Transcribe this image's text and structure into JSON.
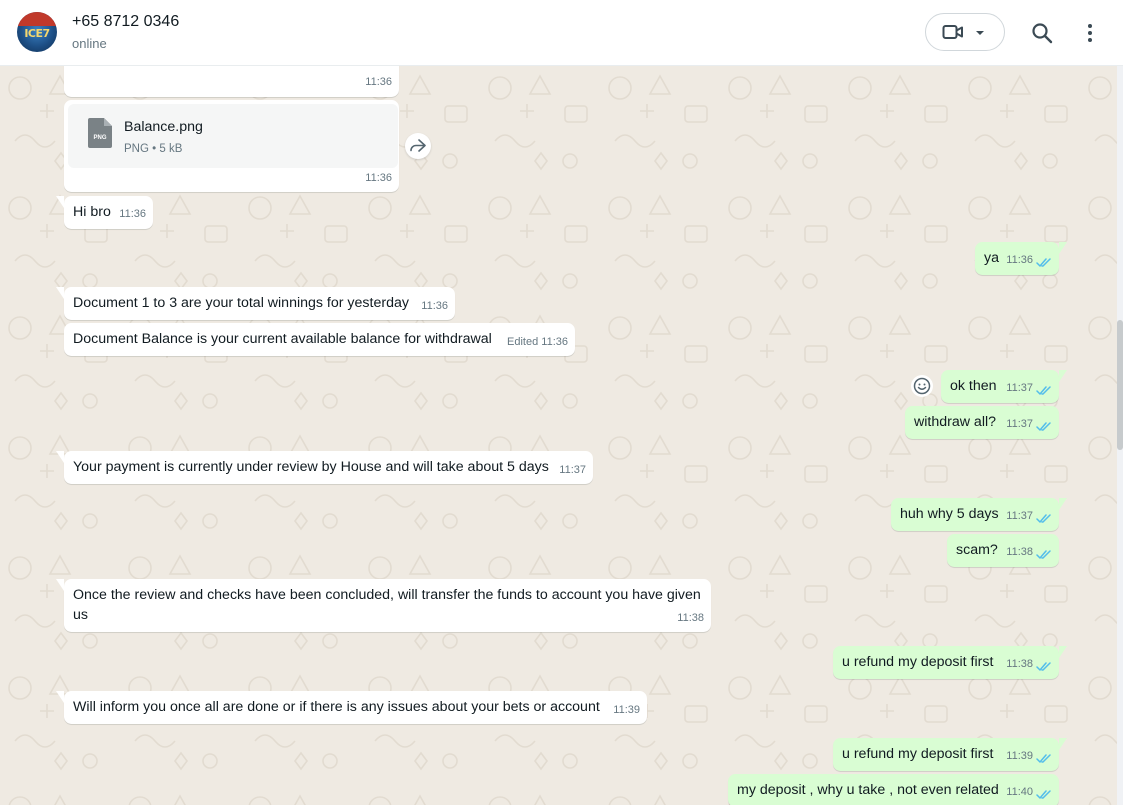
{
  "header": {
    "contact_name": "+65 8712 0346",
    "status": "online",
    "avatar_text": "ICE7",
    "video_icon": "video-camera-icon",
    "search_icon": "search-icon",
    "menu_icon": "kebab-menu-icon"
  },
  "colors": {
    "chat_background": "#efeae2",
    "incoming_bubble": "#ffffff",
    "outgoing_bubble": "#d9fdd3",
    "read_ticks": "#53bdeb"
  },
  "messages": [
    {
      "id": "m0",
      "direction": "in",
      "text": "",
      "time": "11:36"
    },
    {
      "id": "m1",
      "direction": "in",
      "type": "document",
      "file_name": "Balance.png",
      "file_type": "PNG",
      "file_size": "5 kB",
      "doc_icon_label": "PNG",
      "time": "11:36"
    },
    {
      "id": "m2",
      "direction": "in",
      "text": "Hi bro",
      "time": "11:36"
    },
    {
      "id": "m3",
      "direction": "out",
      "text": "ya",
      "time": "11:36",
      "status": "read"
    },
    {
      "id": "m4",
      "direction": "in",
      "text": "Document 1 to 3 are your total winnings for yesterday",
      "time": "11:36"
    },
    {
      "id": "m5",
      "direction": "in",
      "text": "Document Balance is your current available balance for withdrawal",
      "edited_label": "Edited",
      "time": "11:36"
    },
    {
      "id": "m6",
      "direction": "out",
      "text": "ok then",
      "time": "11:37",
      "status": "read"
    },
    {
      "id": "m7",
      "direction": "out",
      "text": "withdraw all?",
      "time": "11:37",
      "status": "read"
    },
    {
      "id": "m8",
      "direction": "in",
      "text": "Your payment is currently under review by House and will take about 5 days",
      "time": "11:37"
    },
    {
      "id": "m9",
      "direction": "out",
      "text": "huh why 5 days",
      "time": "11:37",
      "status": "read"
    },
    {
      "id": "m10",
      "direction": "out",
      "text": "scam?",
      "time": "11:38",
      "status": "read"
    },
    {
      "id": "m11",
      "direction": "in",
      "text_line1": "Once the review and checks have been concluded, will transfer the funds to account you have given",
      "text_line2": "us",
      "time": "11:38"
    },
    {
      "id": "m12",
      "direction": "out",
      "text": "u refund my deposit first",
      "time": "11:38",
      "status": "read"
    },
    {
      "id": "m13",
      "direction": "in",
      "text": "Will inform you once all are done or if there is any issues about your bets or account",
      "time": "11:39"
    },
    {
      "id": "m14",
      "direction": "out",
      "text": "u refund my deposit first",
      "time": "11:39",
      "status": "read"
    },
    {
      "id": "m15",
      "direction": "out",
      "text": "my deposit , why u take , not even related",
      "time": "11:40",
      "status": "read"
    }
  ]
}
